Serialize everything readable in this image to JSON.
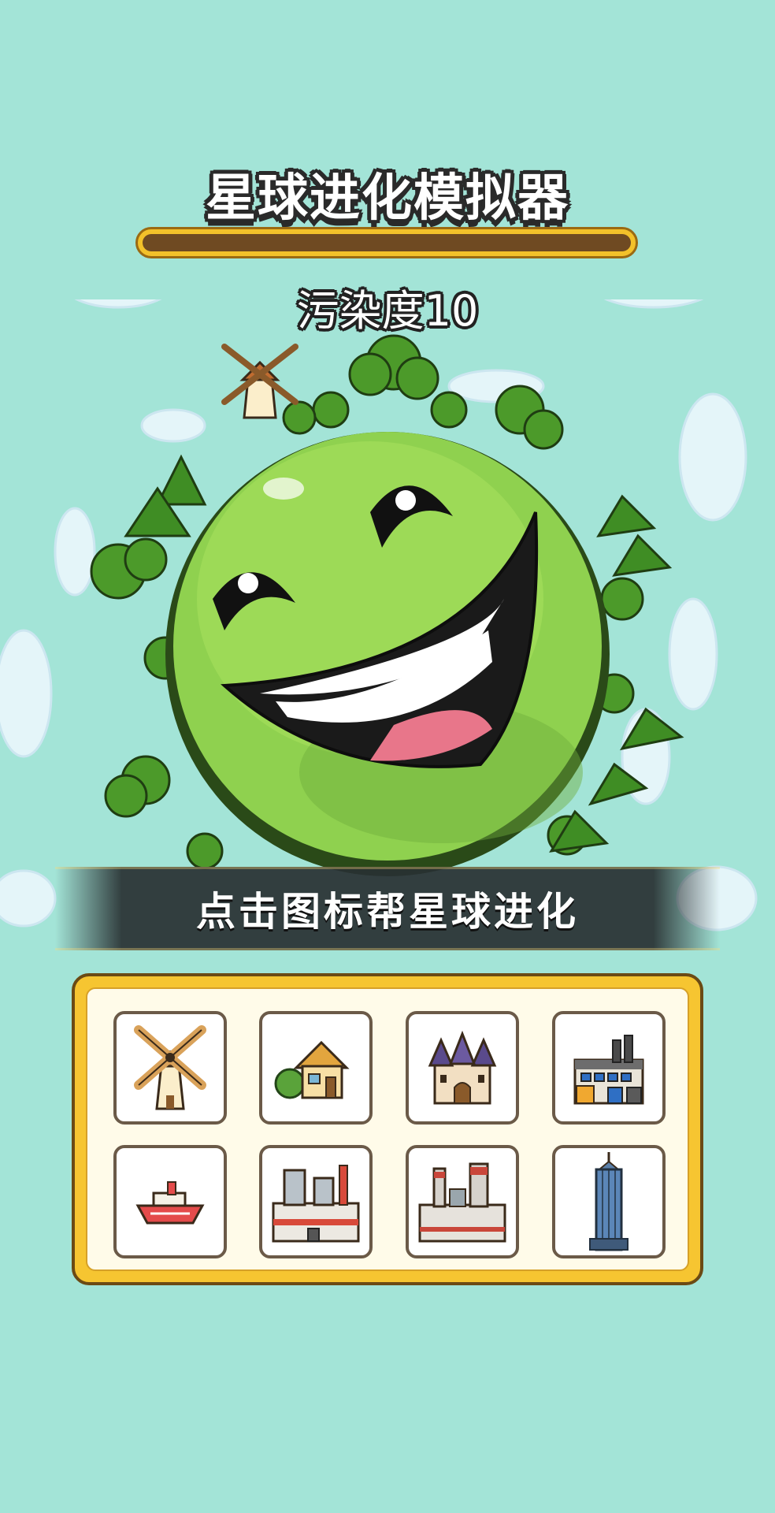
{
  "title": "星球进化模拟器",
  "progress": {
    "value": 0
  },
  "pollution_text": "污染度10",
  "banner_text": "点击图标帮星球进化",
  "buildings": [
    {
      "icon": "windmill-icon"
    },
    {
      "icon": "cottage-icon"
    },
    {
      "icon": "castle-icon"
    },
    {
      "icon": "factory-icon"
    },
    {
      "icon": "ship-icon"
    },
    {
      "icon": "power-plant-icon"
    },
    {
      "icon": "industrial-plant-icon"
    },
    {
      "icon": "skyscraper-icon"
    }
  ],
  "colors": {
    "background": "#a3e4d7",
    "planet": "#8fd14f",
    "panel": "#f6c531"
  }
}
